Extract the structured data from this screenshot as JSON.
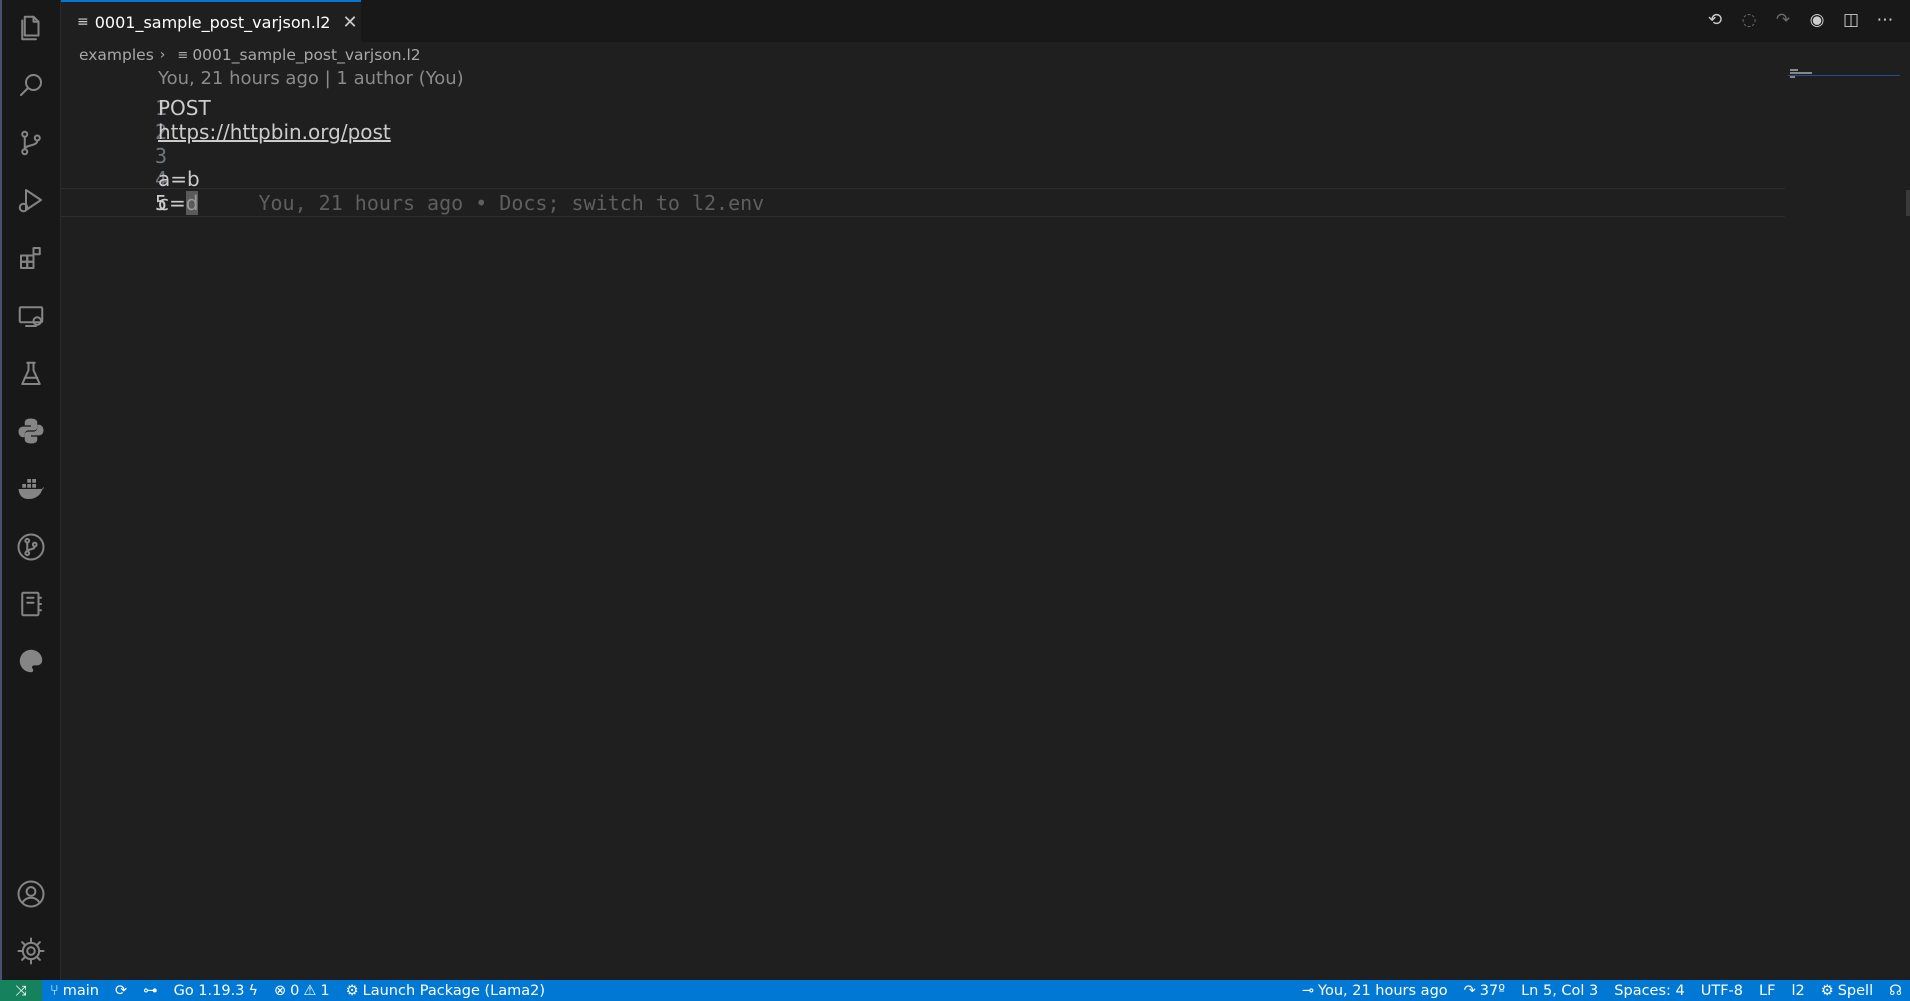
{
  "tab": {
    "label": "0001_sample_post_varjson.l2",
    "file_icon": "≡",
    "close": "✕"
  },
  "tab_actions": [
    {
      "name": "go-back-icon",
      "glyph": "⟲"
    },
    {
      "name": "timeline-icon",
      "glyph": "◌"
    },
    {
      "name": "go-forward-icon",
      "glyph": "↷"
    },
    {
      "name": "copilot-icon",
      "glyph": "◉"
    },
    {
      "name": "split-editor-icon",
      "glyph": "◫"
    },
    {
      "name": "more-actions-icon",
      "glyph": "⋯"
    }
  ],
  "breadcrumb": {
    "folder": "examples",
    "sep": "›",
    "file_icon": "≡",
    "file": "0001_sample_post_varjson.l2"
  },
  "editor": {
    "codelens": "You, 21 hours ago | 1 author (You)",
    "lines": [
      {
        "num": "1",
        "text": "POST"
      },
      {
        "num": "2",
        "text": "https://httpbin.org/post"
      },
      {
        "num": "3",
        "text": ""
      },
      {
        "num": "4",
        "text": "a=b"
      },
      {
        "num": "5",
        "text_before": "c=",
        "text_selected": "d"
      }
    ],
    "blame": "You, 21 hours ago • Docs; switch to l2.env"
  },
  "status": {
    "remote": "⤨",
    "branch": "main",
    "sync": "⟳",
    "go": "Go 1.19.3",
    "errors": "0",
    "warnings": "1",
    "launch": "Launch Package (Lama2)",
    "blame": "You, 21 hours ago",
    "weather": "37º",
    "position": "Ln 5, Col 3",
    "spaces": "Spaces: 4",
    "encoding": "UTF-8",
    "eol": "LF",
    "language": "l2",
    "spell": "Spell"
  },
  "colors": {
    "accent": "#0078d4",
    "remote": "#16825d",
    "editor_bg": "#1f1f1f"
  }
}
